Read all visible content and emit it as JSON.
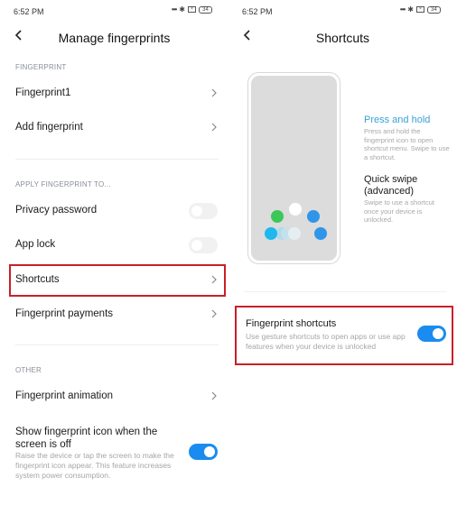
{
  "left": {
    "status": {
      "time": "6:52 PM",
      "battery": "34"
    },
    "header": {
      "title": "Manage fingerprints"
    },
    "sections": {
      "fingerprint": "FINGERPRINT",
      "apply": "APPLY FINGERPRINT TO...",
      "other": "OTHER"
    },
    "items": {
      "fingerprint1": "Fingerprint1",
      "add_fingerprint": "Add fingerprint",
      "privacy_password": "Privacy password",
      "app_lock": "App lock",
      "shortcuts": "Shortcuts",
      "fingerprint_payments": "Fingerprint payments",
      "fingerprint_animation": "Fingerprint animation"
    },
    "toggles": {
      "privacy_password": false,
      "app_lock": false,
      "show_icon": true
    },
    "show_icon": {
      "title": "Show fingerprint icon when the screen is off",
      "description": "Raise the device or tap the screen to make the fingerprint icon appear. This feature increases system power consumption."
    }
  },
  "right": {
    "status": {
      "time": "6:52 PM",
      "battery": "34"
    },
    "header": {
      "title": "Shortcuts"
    },
    "help": {
      "press_hold_title": "Press and hold",
      "press_hold_desc": "Press and hold the fingerprint icon to open shortcut menu. Swipe to use a shortcut.",
      "quick_swipe_title": "Quick swipe (advanced)",
      "quick_swipe_desc": "Swipe to use a shortcut once your device is unlocked."
    },
    "fingerprint_shortcuts": {
      "title": "Fingerprint shortcuts",
      "description": "Use gesture shortcuts to open apps or use app features when your device is unlocked",
      "enabled": true
    }
  },
  "colors": {
    "accent": "#1a8cf0",
    "highlight_border": "#c8202a",
    "press_hold_title": "#3aa0d8",
    "dot_green": "#3cc75a",
    "dot_blue": "#2f95e8",
    "dot_cyan": "#1fb8ee",
    "dot_white": "#ffffff"
  }
}
